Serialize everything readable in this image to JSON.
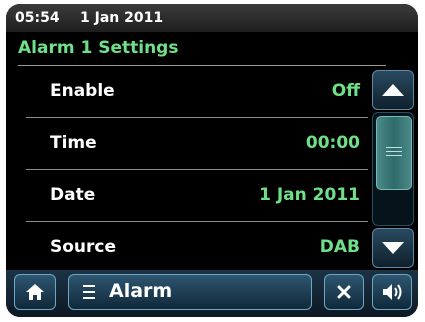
{
  "status": {
    "time": "05:54",
    "date": "1 Jan 2011"
  },
  "page": {
    "title": "Alarm 1 Settings"
  },
  "settings": [
    {
      "label": "Enable",
      "value": "Off"
    },
    {
      "label": "Time",
      "value": "00:00"
    },
    {
      "label": "Date",
      "value": "1 Jan 2011"
    },
    {
      "label": "Source",
      "value": "DAB"
    }
  ],
  "footer": {
    "menu_label": "Alarm"
  },
  "icons": {
    "home": "home-icon",
    "menu": "menu-lines-icon",
    "close": "close-icon",
    "volume": "speaker-icon",
    "scroll_up": "triangle-up-icon",
    "scroll_down": "triangle-down-icon"
  },
  "colors": {
    "accent": "#6fe08a",
    "background": "#000000",
    "button": "#2e5670"
  }
}
